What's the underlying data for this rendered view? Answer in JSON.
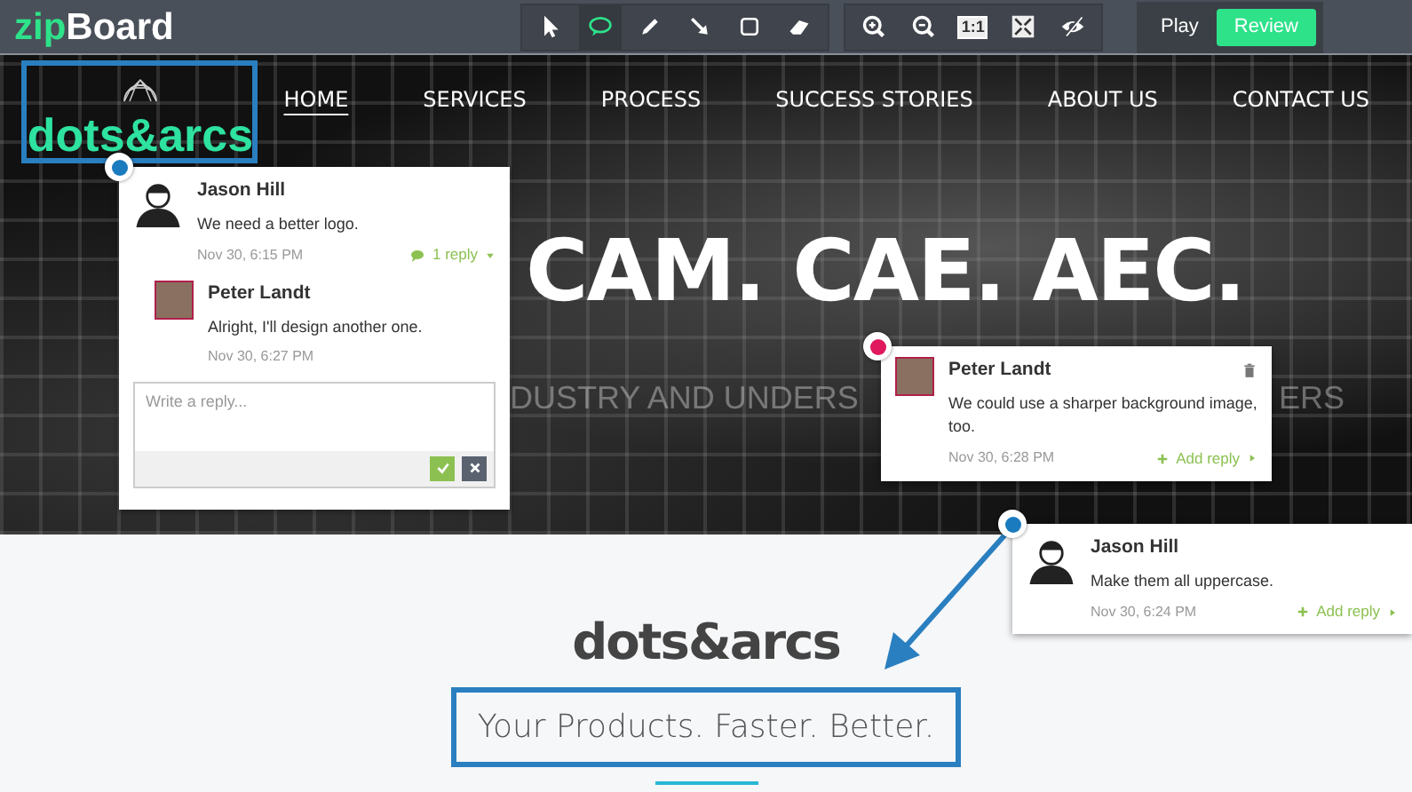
{
  "app": {
    "logo": {
      "prefix": "zip",
      "suffix": "Board"
    },
    "draw_tools": [
      {
        "kind": "pointer",
        "selected": false
      },
      {
        "kind": "comment",
        "selected": true
      },
      {
        "kind": "pencil",
        "selected": false
      },
      {
        "kind": "arrow",
        "selected": false
      },
      {
        "kind": "rectangle",
        "selected": false
      },
      {
        "kind": "eraser",
        "selected": false
      }
    ],
    "view_tools": [
      {
        "kind": "zoom-in"
      },
      {
        "kind": "zoom-out"
      },
      {
        "kind": "actual-size",
        "label": "1:1"
      },
      {
        "kind": "fit"
      },
      {
        "kind": "hide"
      }
    ],
    "modes": [
      {
        "label": "Play",
        "selected": false
      },
      {
        "label": "Review",
        "selected": true
      }
    ]
  },
  "site": {
    "logo": "dots&arcs",
    "nav": [
      {
        "label": "HOME",
        "selected": true
      },
      {
        "label": "SERVICES",
        "selected": false
      },
      {
        "label": "PROCESS",
        "selected": false
      },
      {
        "label": "SUCCESS STORIES",
        "selected": false
      },
      {
        "label": "ABOUT US",
        "selected": false
      },
      {
        "label": "CONTACT US",
        "selected": false
      }
    ],
    "hero_title": "CAM. CAE. AEC.",
    "hero_subtitle_fragments": [
      "DUSTRY AND UNDERS",
      "ERS"
    ],
    "brand": "dots&arcs",
    "tagline": "Your Products. Faster. Better."
  },
  "comments": [
    {
      "color": "#1a7bbf",
      "author": "Jason Hill",
      "kind": "illustration",
      "text": "We need a better logo.",
      "time": "Nov 30, 6:15 PM",
      "reply_toggle": "1 reply",
      "expanded": true,
      "replies": [
        {
          "author": "Peter Landt",
          "kind": "photo",
          "text": "Alright, I'll design another one.",
          "time": "Nov 30, 6:27 PM"
        }
      ],
      "reply_placeholder": "Write a reply..."
    },
    {
      "color": "#e0185e",
      "author": "Peter Landt",
      "kind": "photo",
      "text": "We could use a sharper background image, too.",
      "time": "Nov 30, 6:28 PM",
      "add_reply": "Add reply",
      "deletable": true
    },
    {
      "color": "#1a7bbf",
      "author": "Jason Hill",
      "kind": "illustration",
      "text": "Make them all uppercase.",
      "time": "Nov 30, 6:24 PM",
      "add_reply": "Add reply",
      "deletable": false
    }
  ]
}
